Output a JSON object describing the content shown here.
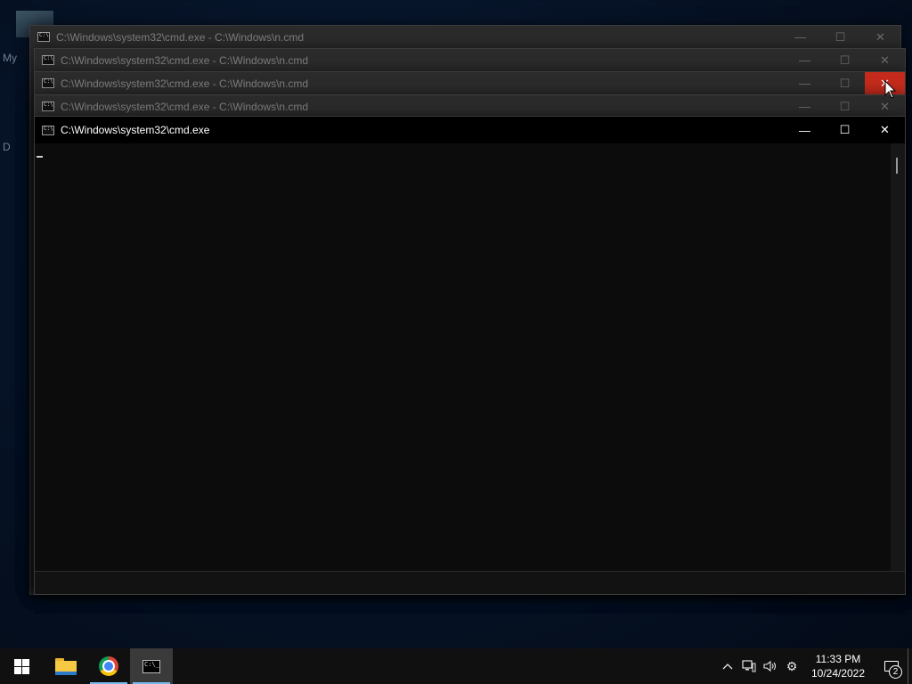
{
  "desktop": {
    "labels": [
      "My",
      "D"
    ]
  },
  "windows": {
    "background_title": "C:\\Windows\\system32\\cmd.exe - C:\\Windows\\n.cmd",
    "active_title": "C:\\Windows\\system32\\cmd.exe"
  },
  "controls": {
    "minimize": "—",
    "maximize": "☐",
    "close": "✕"
  },
  "taskbar": {
    "apps": [
      "start-icon",
      "file-explorer-icon",
      "chrome-icon",
      "cmd-icon"
    ],
    "tray": {
      "chevron": "^",
      "network": "🖧",
      "volume": "🔊",
      "settings": "⚙"
    },
    "time": "11:33 PM",
    "date": "10/24/2022",
    "notification_count": "2"
  },
  "colors": {
    "close_hover": "#c42b1c",
    "taskbar_accent": "#76b9ed"
  }
}
